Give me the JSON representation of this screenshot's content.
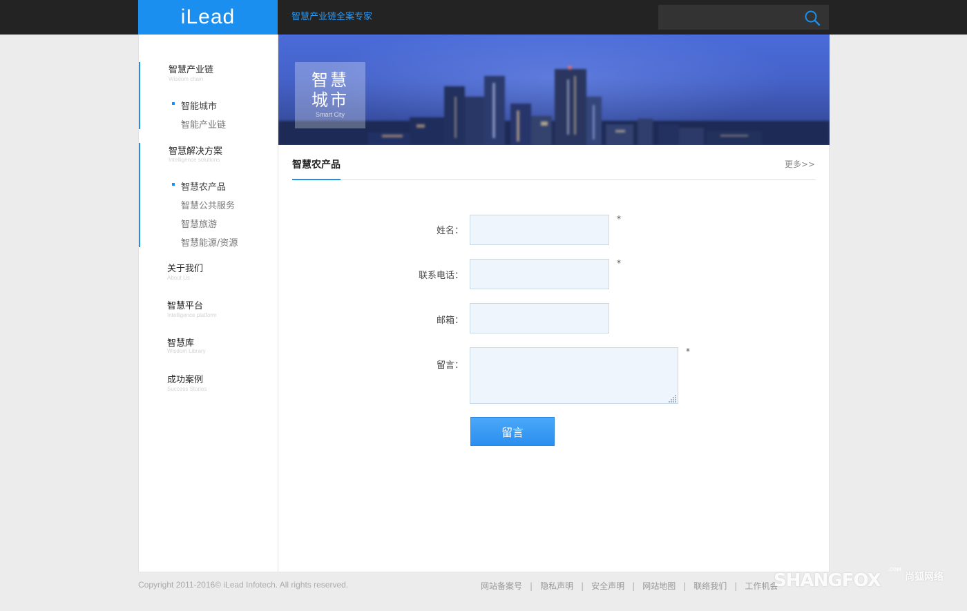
{
  "header": {
    "logo": "iLead",
    "slogan": "智慧产业链全案专家",
    "search": {
      "placeholder": "",
      "icon": "search-icon"
    }
  },
  "colors": {
    "accent": "#1a8ff0",
    "topbar": "#232323",
    "input_bg": "#eef5fd"
  },
  "sidebar": {
    "groups": [
      {
        "title": "智慧产业链",
        "subtitle": "Wisdom chain",
        "items": [
          {
            "label": "智能城市",
            "current": true
          },
          {
            "label": "智能产业链",
            "current": false
          }
        ]
      },
      {
        "title": "智慧解决方案",
        "subtitle": "Intelligence solutions",
        "items": [
          {
            "label": "智慧农产品",
            "current": true
          },
          {
            "label": "智慧公共服务",
            "current": false
          },
          {
            "label": "智慧旅游",
            "current": false
          },
          {
            "label": "智慧能源/资源",
            "current": false
          }
        ]
      },
      {
        "title": "关于我们",
        "subtitle": "About Us"
      },
      {
        "title": "智慧平台",
        "subtitle": "Intelligence platform"
      },
      {
        "title": "智慧库",
        "subtitle": "Wisdom Library"
      },
      {
        "title": "成功案例",
        "subtitle": "Success Stories"
      }
    ]
  },
  "banner": {
    "title_line1": "智慧",
    "title_line2": "城市",
    "subtitle": "Smart City"
  },
  "section": {
    "title": "智慧农产品",
    "more": "更多>>"
  },
  "form": {
    "name_label": "姓名：",
    "phone_label": "联系电话：",
    "email_label": "邮箱：",
    "message_label": "留言：",
    "required_mark": "*",
    "submit_label": "留言",
    "name_value": "",
    "phone_value": "",
    "email_value": "",
    "message_value": ""
  },
  "footer": {
    "copyright": "Copyright 2011-2016© iLead Infotech. All rights reserved.",
    "links": [
      "网站备案号",
      "隐私声明",
      "安全声明",
      "网站地图",
      "联络我们",
      "工作机会"
    ],
    "separator": "|"
  },
  "watermark": {
    "text": "SHANGFOX",
    "com": ".COM",
    "cn": "尚狐网络"
  }
}
